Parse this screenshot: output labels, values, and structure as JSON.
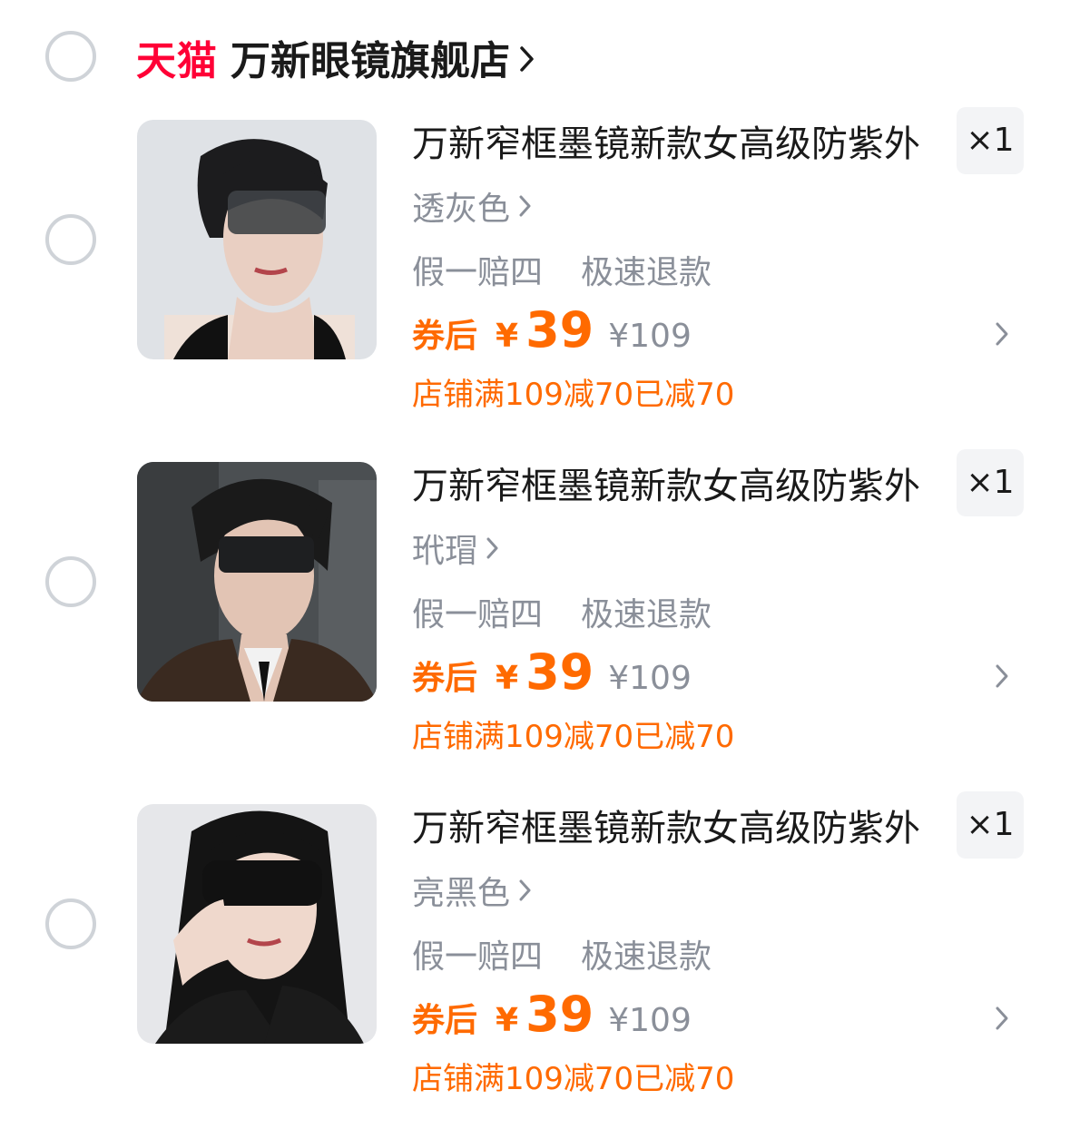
{
  "shop": {
    "brand": "天猫",
    "name": "万新眼镜旗舰店"
  },
  "items": [
    {
      "title": "万新窄框墨镜新款女高级防紫外",
      "variant": "透灰色",
      "services": [
        "假一赔四",
        "极速退款"
      ],
      "price_label": "券后",
      "currency": "¥",
      "price": "39",
      "original_price": "¥109",
      "promo": "店铺满109减70已减70",
      "quantity": "×1"
    },
    {
      "title": "万新窄框墨镜新款女高级防紫外",
      "variant": "玳瑁",
      "services": [
        "假一赔四",
        "极速退款"
      ],
      "price_label": "券后",
      "currency": "¥",
      "price": "39",
      "original_price": "¥109",
      "promo": "店铺满109减70已减70",
      "quantity": "×1"
    },
    {
      "title": "万新窄框墨镜新款女高级防紫外",
      "variant": "亮黑色",
      "services": [
        "假一赔四",
        "极速退款"
      ],
      "price_label": "券后",
      "currency": "¥",
      "price": "39",
      "original_price": "¥109",
      "promo": "店铺满109减70已减70",
      "quantity": "×1"
    }
  ],
  "colors": {
    "brand_red": "#ff0036",
    "accent_orange": "#ff6a00",
    "muted_gray": "#8a8f99",
    "radio_border": "#cfd3d8"
  }
}
